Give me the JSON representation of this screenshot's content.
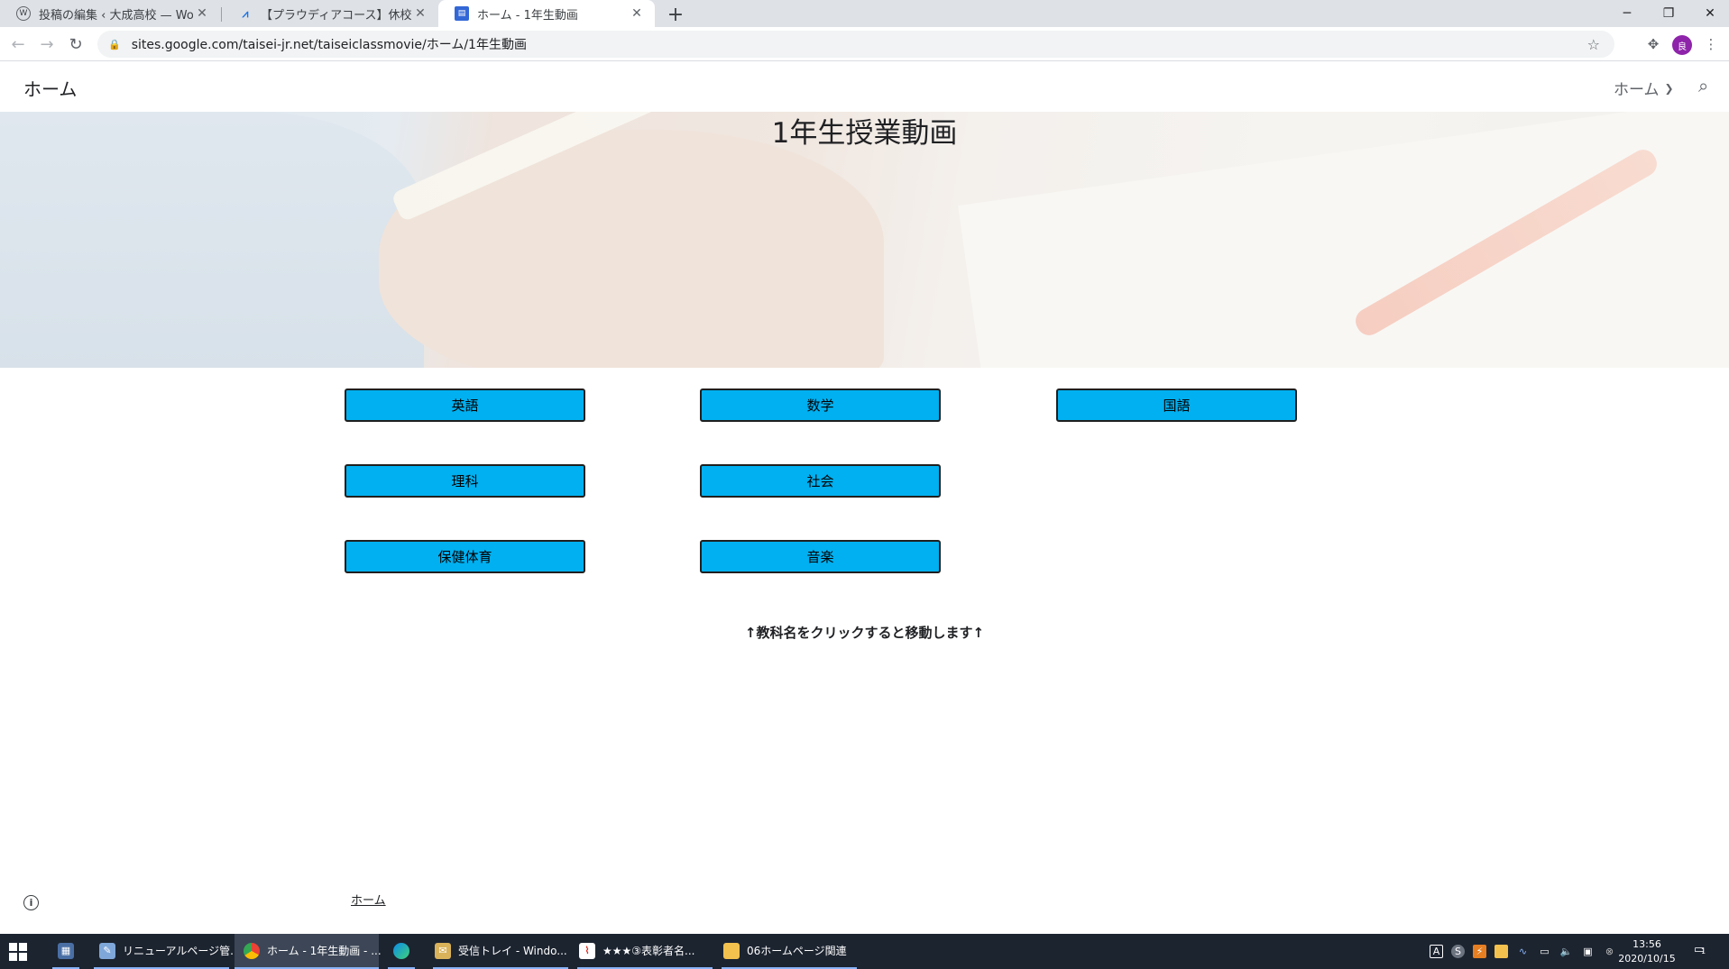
{
  "browser": {
    "tabs": [
      {
        "label": "投稿の編集 ‹ 大成高校 — WordPress",
        "icon": "wordpress-icon",
        "active": false
      },
      {
        "label": "【プラウディアコース】休校中課題動画",
        "icon": "sites-logo-icon",
        "active": false
      },
      {
        "label": "ホーム - 1年生動画",
        "icon": "google-sites-icon",
        "active": true
      }
    ],
    "new_tab_glyph": "+",
    "url": "sites.google.com/taisei-jr.net/taiseiclassmovie/ホーム/1年生動画",
    "profile_initial": "良"
  },
  "site": {
    "title": "ホーム",
    "nav_label": "ホーム",
    "hero_title": "1年生授業動画",
    "subjects": [
      {
        "label": "英語"
      },
      {
        "label": "数学"
      },
      {
        "label": "国語"
      },
      {
        "label": "理科"
      },
      {
        "label": "社会"
      },
      {
        "label": "保健体育"
      },
      {
        "label": "音楽"
      }
    ],
    "hint": "↑教科名をクリックすると移動します↑",
    "footer_link": "ホーム"
  },
  "taskbar": {
    "apps": [
      {
        "label": "",
        "icon": "calculator-icon"
      },
      {
        "label": "リニューアルページ管...",
        "icon": "notepad-icon"
      },
      {
        "label": "ホーム - 1年生動画 - ...",
        "icon": "chrome-icon"
      },
      {
        "label": "",
        "icon": "edge-icon"
      },
      {
        "label": "受信トレイ - Windo...",
        "icon": "mail-icon"
      },
      {
        "label": "★★★③表彰者名...",
        "icon": "pdf-icon"
      },
      {
        "label": "06ホームページ関連",
        "icon": "folder-icon"
      }
    ],
    "time": "13:56",
    "date": "2020/10/15",
    "notification_count": "1"
  },
  "colors": {
    "button_fill": "#00b0f0",
    "button_border": "#1f1f1f",
    "taskbar_bg": "#1c2430",
    "tabstrip_bg": "#dee1e6"
  }
}
